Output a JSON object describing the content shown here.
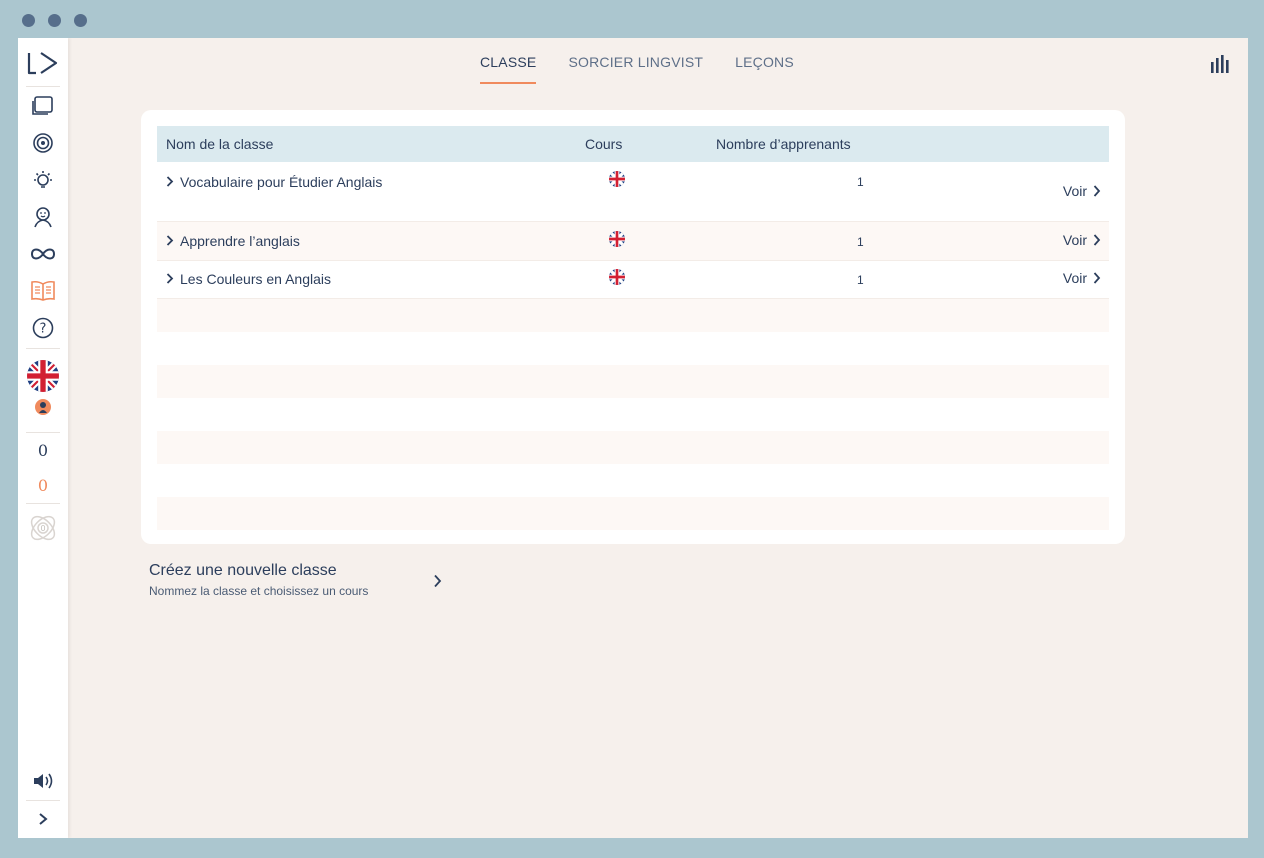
{
  "window_controls": [
    "dot",
    "dot",
    "dot"
  ],
  "sidebar": {
    "counter_blue": "0",
    "counter_orange": "0",
    "badge_value": "0",
    "accent_color": "#f08a5d",
    "navy_color": "#2c3e5c"
  },
  "tabs": [
    {
      "label": "CLASSE",
      "active": true
    },
    {
      "label": "SORCIER LINGVIST",
      "active": false
    },
    {
      "label": "LEÇONS",
      "active": false
    }
  ],
  "table": {
    "headers": {
      "name": "Nom de la classe",
      "course": "Cours",
      "count": "Nombre d’apprenants"
    },
    "rows": [
      {
        "name": "Vocabulaire pour Étudier Anglais",
        "course_flag": "uk-flag-icon",
        "learners": "1",
        "action": "Voir"
      },
      {
        "name": "Apprendre l’anglais",
        "course_flag": "uk-flag-icon",
        "learners": "1",
        "action": "Voir"
      },
      {
        "name": "Les Couleurs en Anglais",
        "course_flag": "uk-flag-icon",
        "learners": "1",
        "action": "Voir"
      }
    ]
  },
  "new_class": {
    "title": "Créez une nouvelle classe",
    "subtitle": "Nommez la classe et choisissez un cours"
  }
}
